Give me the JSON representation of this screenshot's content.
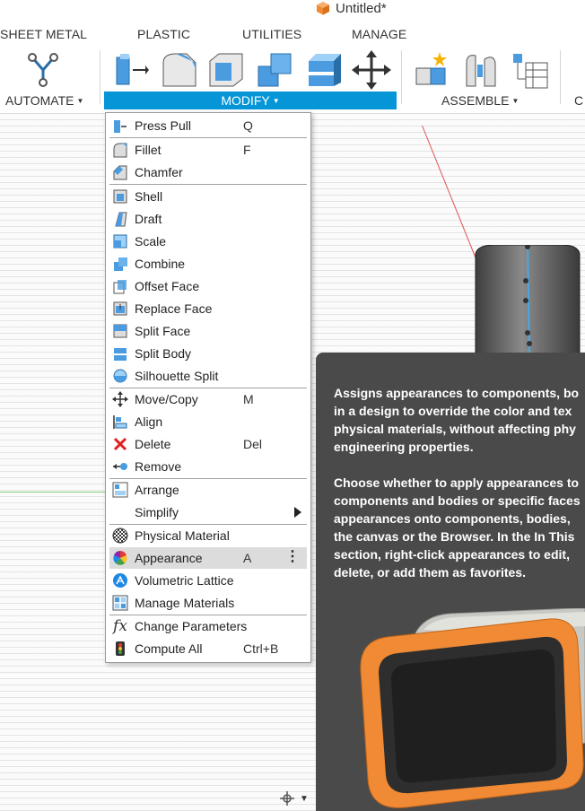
{
  "window": {
    "title": "Untitled*",
    "icon": "orange-cube-icon"
  },
  "ribbon": {
    "tabs": [
      "SHEET METAL",
      "PLASTIC",
      "UTILITIES",
      "MANAGE"
    ],
    "groups": {
      "automate": "AUTOMATE",
      "modify": "MODIFY",
      "assemble": "ASSEMBLE",
      "truncated": "C"
    },
    "accent": "#0696d7"
  },
  "menu": {
    "items": [
      {
        "label": "Press Pull",
        "shortcut": "Q",
        "icon": "press-pull-icon"
      },
      {
        "label": "Fillet",
        "shortcut": "F",
        "icon": "fillet-icon"
      },
      {
        "label": "Chamfer",
        "shortcut": "",
        "icon": "chamfer-icon"
      },
      {
        "label": "Shell",
        "shortcut": "",
        "icon": "shell-icon"
      },
      {
        "label": "Draft",
        "shortcut": "",
        "icon": "draft-icon"
      },
      {
        "label": "Scale",
        "shortcut": "",
        "icon": "scale-icon"
      },
      {
        "label": "Combine",
        "shortcut": "",
        "icon": "combine-icon"
      },
      {
        "label": "Offset Face",
        "shortcut": "",
        "icon": "offset-face-icon"
      },
      {
        "label": "Replace Face",
        "shortcut": "",
        "icon": "replace-face-icon"
      },
      {
        "label": "Split Face",
        "shortcut": "",
        "icon": "split-face-icon"
      },
      {
        "label": "Split Body",
        "shortcut": "",
        "icon": "split-body-icon"
      },
      {
        "label": "Silhouette Split",
        "shortcut": "",
        "icon": "silhouette-split-icon"
      },
      {
        "label": "Move/Copy",
        "shortcut": "M",
        "icon": "move-copy-icon"
      },
      {
        "label": "Align",
        "shortcut": "",
        "icon": "align-icon"
      },
      {
        "label": "Delete",
        "shortcut": "Del",
        "icon": "delete-icon"
      },
      {
        "label": "Remove",
        "shortcut": "",
        "icon": "remove-icon"
      },
      {
        "label": "Arrange",
        "shortcut": "",
        "icon": "arrange-icon"
      },
      {
        "label": "Simplify",
        "shortcut": "",
        "icon": ""
      },
      {
        "label": "Physical Material",
        "shortcut": "",
        "icon": "physical-material-icon"
      },
      {
        "label": "Appearance",
        "shortcut": "A",
        "icon": "appearance-icon"
      },
      {
        "label": "Volumetric Lattice",
        "shortcut": "",
        "icon": "volumetric-lattice-icon"
      },
      {
        "label": "Manage Materials",
        "shortcut": "",
        "icon": "manage-materials-icon"
      },
      {
        "label": "Change Parameters",
        "shortcut": "",
        "icon": "change-parameters-icon"
      },
      {
        "label": "Compute All",
        "shortcut": "Ctrl+B",
        "icon": "compute-all-icon"
      }
    ]
  },
  "tooltip": {
    "para1": [
      "Assigns appearances to components, bo",
      "in a design to override the color and tex",
      "physical materials, without affecting phy",
      "engineering properties."
    ],
    "para2": [
      "Choose whether to apply appearances to",
      "components and bodies or specific faces",
      "appearances onto components, bodies, ",
      "the canvas or the Browser. In the In This",
      "section, right-click appearances to edit,",
      "delete, or add them as favorites."
    ]
  },
  "colors": {
    "menu_highlight": "#dcdcdc",
    "tooltip_bg": "#4a4a4a",
    "orange": "#f08a34"
  }
}
